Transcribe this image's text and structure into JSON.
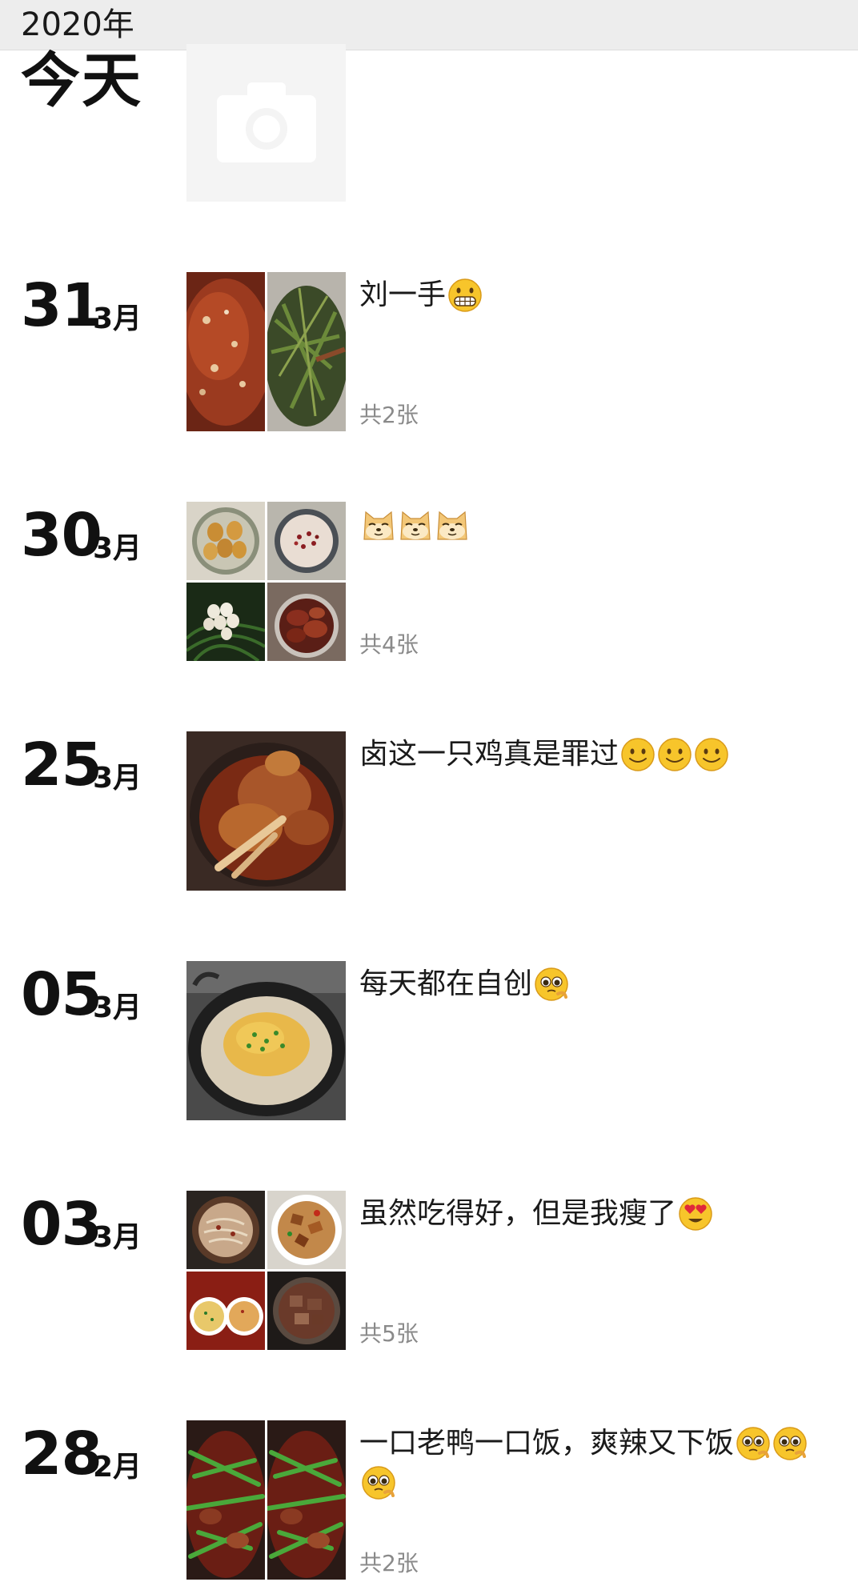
{
  "year_header": "2020年",
  "today": {
    "label": "今天",
    "upload_icon": "camera-icon"
  },
  "entries": [
    {
      "day": "31",
      "month": "3月",
      "caption": "刘一手",
      "emojis": [
        "grin-emoji"
      ],
      "photo_count": "共2张",
      "photos": [
        "spicy-hotpot-photo",
        "stir-fried-greens-photo"
      ]
    },
    {
      "day": "30",
      "month": "3月",
      "caption": "",
      "emojis": [
        "doge-emoji",
        "doge-emoji",
        "doge-emoji"
      ],
      "photo_count": "共4张",
      "photos": [
        "braised-eggs-photo",
        "congee-photo",
        "boiled-eggs-photo",
        "braised-meat-photo"
      ]
    },
    {
      "day": "25",
      "month": "3月",
      "caption": "卤这一只鸡真是罪过",
      "emojis": [
        "smile-emoji",
        "smile-emoji",
        "smile-emoji"
      ],
      "photo_count": "",
      "photos": [
        "braised-chicken-photo"
      ]
    },
    {
      "day": "05",
      "month": "3月",
      "caption": "每天都在自创",
      "emojis": [
        "pleading-emoji"
      ],
      "photo_count": "",
      "photos": [
        "egg-noodle-wok-photo"
      ]
    },
    {
      "day": "03",
      "month": "3月",
      "caption": "虽然吃得好，但是我瘦了",
      "emojis": [
        "heart-eyes-emoji"
      ],
      "photo_count": "共5张",
      "photos": [
        "noodle-bowl-photo",
        "fried-pork-photo",
        "two-noodle-bowls-photo",
        "braised-beef-photo"
      ]
    },
    {
      "day": "28",
      "month": "2月",
      "caption": "一口老鸭一口饭，爽辣又下饭",
      "emojis": [
        "pleading-emoji",
        "pleading-emoji",
        "pleading-emoji"
      ],
      "photo_count": "共2张",
      "photos": [
        "duck-with-scallion-photo",
        "duck-with-scallion-photo"
      ]
    }
  ],
  "colors": {
    "year_bar_bg": "#ededed",
    "text": "#111111",
    "count_text": "#8a8a8a",
    "emoji_yellow": "#f7c52b"
  }
}
